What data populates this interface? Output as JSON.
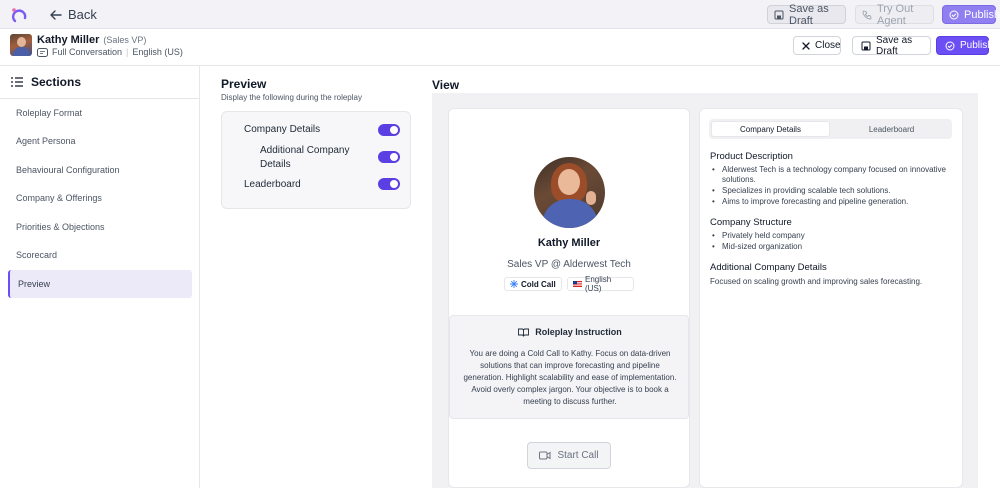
{
  "topbar": {
    "back_label": "Back",
    "save_draft_label": "Save as Draft",
    "try_agent_label": "Try Out Agent",
    "publish_label": "Publish"
  },
  "header": {
    "name": "Kathy Miller",
    "role": "(Sales VP)",
    "mode": "Full Conversation",
    "language": "English (US)",
    "close_label": "Close",
    "save_draft_label": "Save as Draft",
    "publish_label": "Publish"
  },
  "sidebar": {
    "title": "Sections",
    "items": [
      {
        "label": "Roleplay Format"
      },
      {
        "label": "Agent Persona"
      },
      {
        "label": "Behavioural Configuration"
      },
      {
        "label": "Company & Offerings"
      },
      {
        "label": "Priorities & Objections"
      },
      {
        "label": "Scorecard"
      },
      {
        "label": "Preview"
      }
    ]
  },
  "preview": {
    "title": "Preview",
    "subtitle": "Display the following during the roleplay",
    "options": [
      {
        "label": "Company Details",
        "enabled": true
      },
      {
        "label_line1": "Additional Company",
        "label_line2": "Details",
        "enabled": true
      },
      {
        "label": "Leaderboard",
        "enabled": true
      }
    ]
  },
  "view": {
    "title": "View",
    "persona_name": "Kathy Miller",
    "persona_role": "Sales VP @ Alderwest Tech",
    "call_type": "Cold Call",
    "language": "English (US)",
    "instruction_title": "Roleplay Instruction",
    "instruction_text": "You are doing a Cold Call to Kathy. Focus on data-driven solutions that can improve forecasting and pipeline generation. Highlight scalability and ease of implementation. Avoid overly complex jargon. Your objective is to book a meeting to discuss further.",
    "start_call_label": "Start Call",
    "tabs": [
      "Company Details",
      "Leaderboard"
    ],
    "product_description_title": "Product Description",
    "product_description": [
      "Alderwest Tech is a technology company focused on innovative solutions.",
      "Specializes in providing scalable tech solutions.",
      "Aims to improve forecasting and pipeline generation."
    ],
    "company_structure_title": "Company Structure",
    "company_structure": [
      "Privately held company",
      "Mid-sized organization"
    ],
    "additional_details_title": "Additional Company Details",
    "additional_details": "Focused on scaling growth and improving sales forecasting."
  },
  "colors": {
    "accent": "#6c4ef5",
    "toggle_on": "#5b3fe3"
  }
}
